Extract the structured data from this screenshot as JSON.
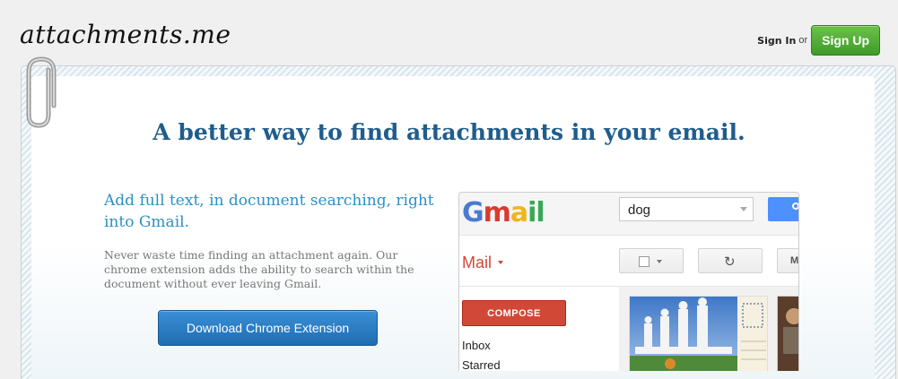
{
  "header": {
    "logo": "attachments.me",
    "sign_in": "Sign In",
    "or": "or",
    "sign_up": "Sign Up"
  },
  "hero": {
    "headline": "A better way to find attachments in your email.",
    "subhead": "Add full text, in document searching, right into Gmail.",
    "description": "Never waste time finding an attachment again. Our chrome extension adds the ability to search within the document without ever leaving Gmail.",
    "download_button": "Download Chrome Extension"
  },
  "gmail_preview": {
    "search_value": "dog",
    "mail_label": "Mail",
    "compose_label": "COMPOSE",
    "nav": [
      "Inbox",
      "Starred"
    ],
    "more_label": "M"
  },
  "colors": {
    "headline": "#1f5d8c",
    "subhead": "#2d8fc7",
    "signup": "#4ea62f",
    "download": "#2a7cc4",
    "compose": "#d14836"
  }
}
